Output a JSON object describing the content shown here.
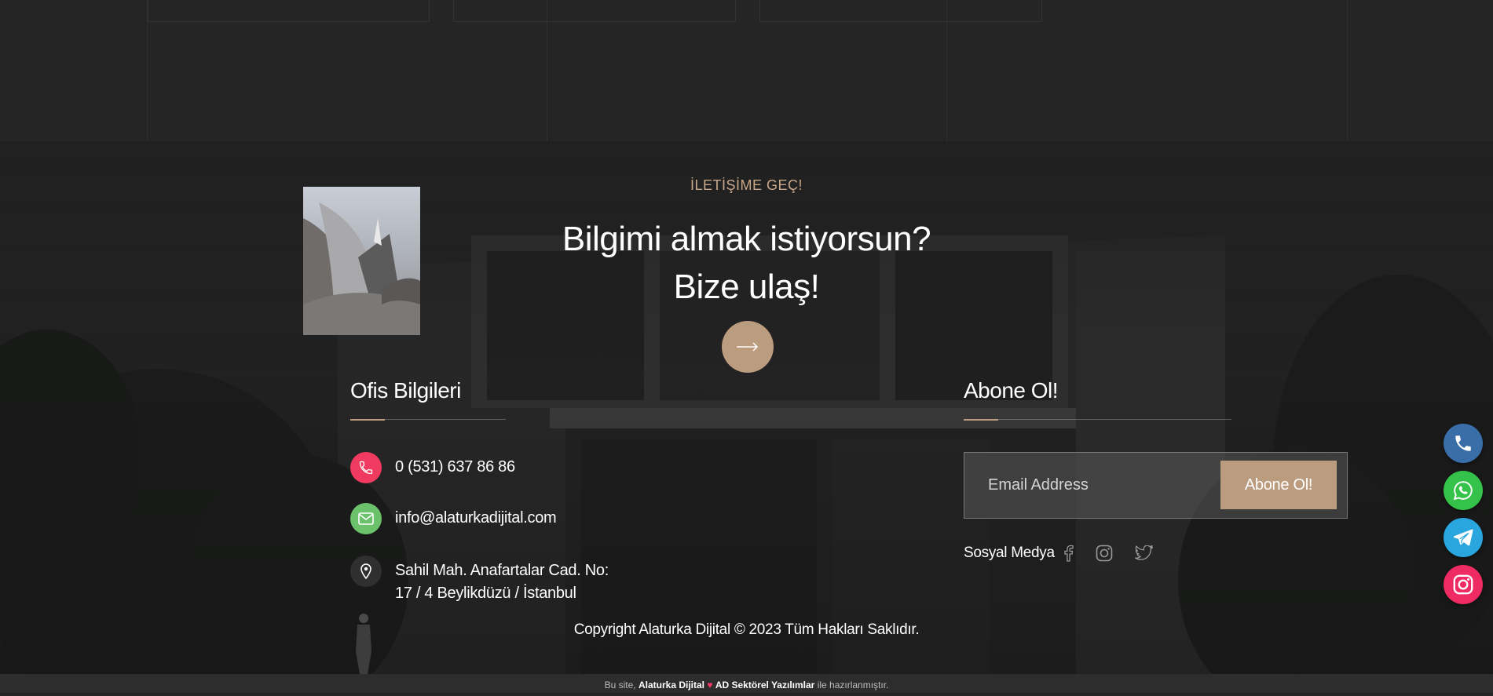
{
  "contact_cta": {
    "eyebrow": "İLETİŞİME GEÇ!",
    "headline_line1": "Bilgimi almak istiyorsun?",
    "headline_line2": "Bize ulaş!",
    "arrow_icon": "arrow-right-icon"
  },
  "office": {
    "title": "Ofis Bilgileri",
    "phone": "0 (531) 637 86 86",
    "email": "info@alaturkadijital.com",
    "address_line1": "Sahil Mah. Anafartalar Cad. No:",
    "address_line2": "17 / 4 Beylikdüzü / İstanbul"
  },
  "subscribe": {
    "title": "Abone Ol!",
    "email_placeholder": "Email Address",
    "button_label": "Abone Ol!",
    "social_label": "Sosyal Medya",
    "social_icons": [
      "facebook-icon",
      "instagram-icon",
      "twitter-icon"
    ]
  },
  "copyright": "Copyright Alaturka Dijital © 2023 Tüm Hakları Saklıdır.",
  "credit": {
    "prefix": "Bu site,",
    "brand": "Alaturka Dijital",
    "product": "AD Sektörel Yazılımlar",
    "suffix": "ile hazırlanmıştır."
  },
  "floating_buttons": [
    "phone-icon",
    "whatsapp-icon",
    "telegram-icon",
    "instagram-icon"
  ],
  "colors": {
    "accent": "#bb9c7e",
    "phone_icon_bg": "#f03a5f",
    "email_icon_bg": "#6cc26a",
    "location_icon_bg": "#2f2f2f",
    "fab_phone": "#3a6ea8",
    "fab_whatsapp": "#35c24a",
    "fab_telegram": "#2aa6df",
    "fab_instagram": "#ef2b63"
  }
}
